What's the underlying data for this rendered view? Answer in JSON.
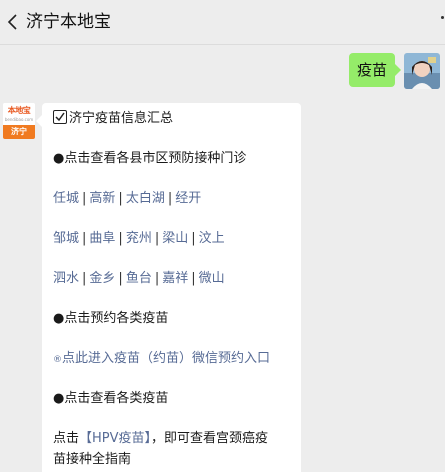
{
  "header": {
    "title": "济宁本地宝"
  },
  "outgoing": {
    "text": "疫苗"
  },
  "brand_avatar": {
    "name": "本地宝",
    "url": "bendibao.com",
    "city": "济宁"
  },
  "message": {
    "title": "济宁疫苗信息汇总",
    "bullet_counties": "●点击查看各县市区预防接种门诊",
    "counties_row1": [
      "任城",
      "高新",
      "太白湖",
      "经开"
    ],
    "counties_row2": [
      "邹城",
      "曲阜",
      "兖州",
      "梁山",
      "汶上"
    ],
    "counties_row3": [
      "泗水",
      "金乡",
      "鱼台",
      "嘉祥",
      "微山"
    ],
    "separator": "|",
    "bullet_book": "●点击预约各类疫苗",
    "book_icon": "®",
    "book_link": "点此进入疫苗（约苗）微信预约入口",
    "bullet_view": "●点击查看各类疫苗",
    "hpv_prefix": "点击",
    "hpv_link": "【HPV疫苗】",
    "hpv_suffix": "，即可查看宫颈癌疫",
    "hpv_line2": "苗接种全指南"
  },
  "colors": {
    "bubble_green": "#95ec69",
    "link_blue": "#576b95",
    "brand_orange": "#f07a20"
  }
}
